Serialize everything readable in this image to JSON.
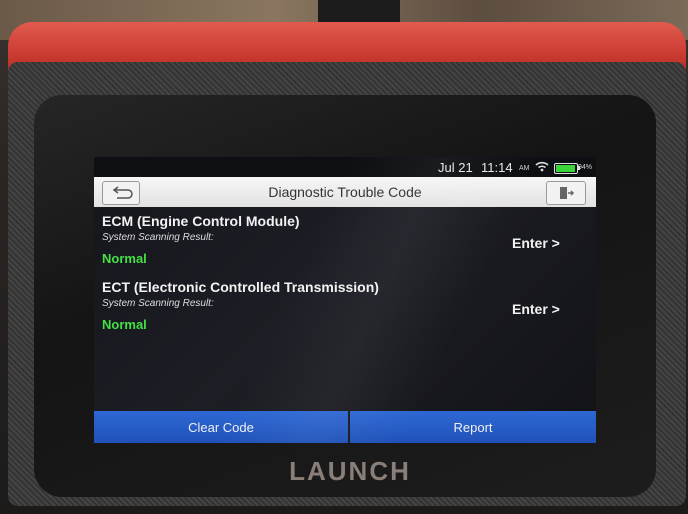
{
  "statusbar": {
    "date": "Jul 21",
    "time": "11:14",
    "ampm": "AM",
    "battery_percent": "94%",
    "icons": [
      "wifi-icon",
      "battery-icon"
    ]
  },
  "titlebar": {
    "title": "Diagnostic Trouble Code",
    "back_icon": "back-arrow-icon",
    "exit_icon": "exit-icon"
  },
  "items": [
    {
      "name": "ECM (Engine Control Module)",
      "subtitle": "System Scanning Result:",
      "status": "Normal",
      "action": "Enter >"
    },
    {
      "name": "ECT (Electronic Controlled Transmission)",
      "subtitle": "System Scanning Result:",
      "status": "Normal",
      "action": "Enter >"
    }
  ],
  "buttons": {
    "clear_code": "Clear Code",
    "report": "Report"
  },
  "device": {
    "brand": "LAUNCH"
  },
  "colors": {
    "bumper": "#c8392f",
    "button_blue": "#2e68d4",
    "status_green": "#44e044",
    "titlebar": "#ececec"
  }
}
